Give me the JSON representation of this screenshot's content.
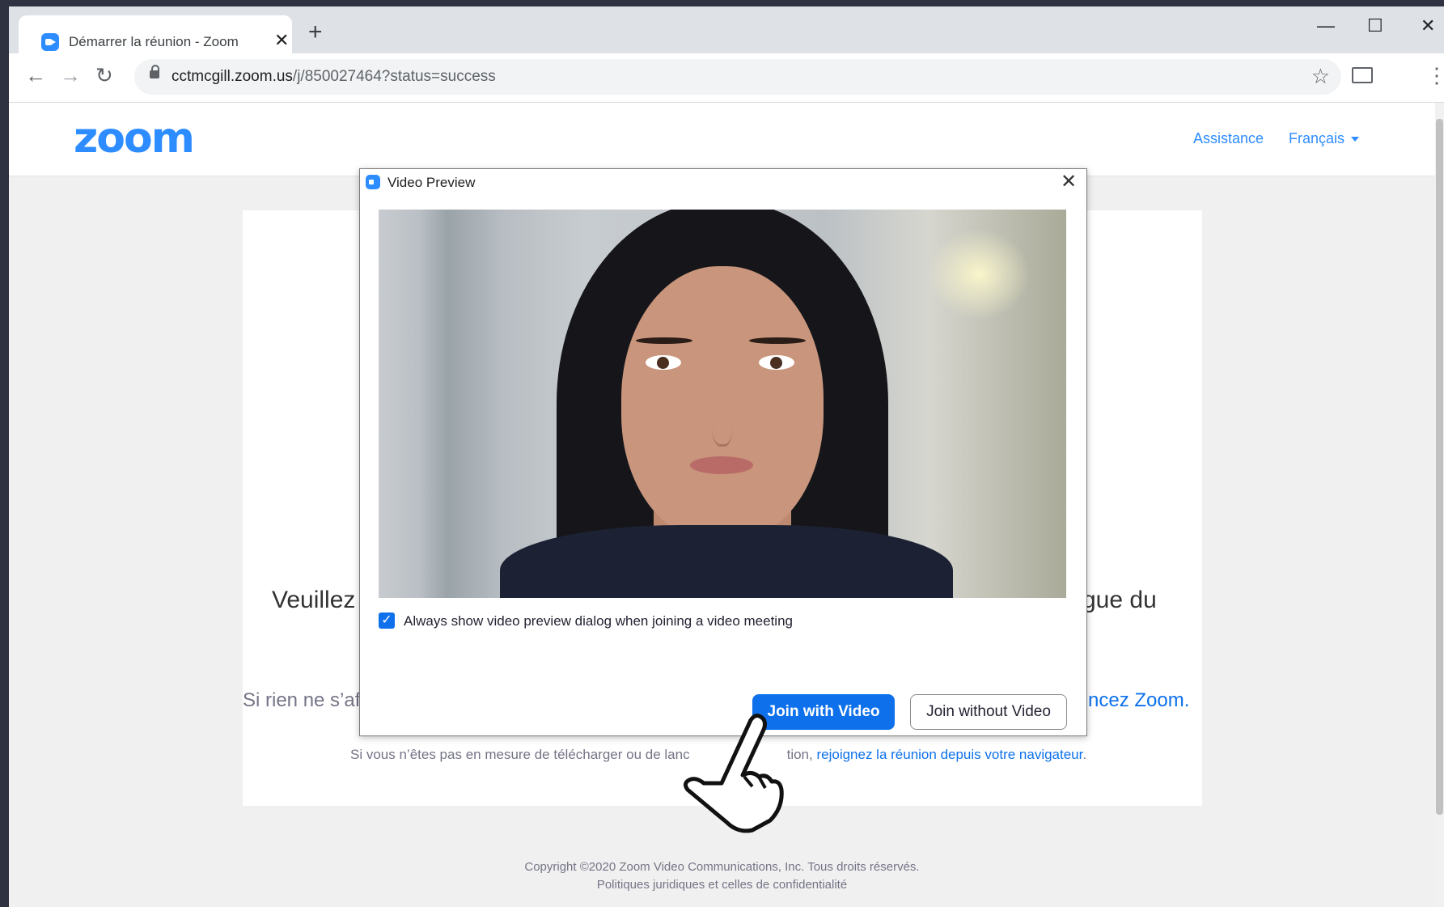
{
  "browser": {
    "tab_title": "Démarrer la réunion - Zoom",
    "tab_close": "✕",
    "new_tab": "+",
    "url_host": "cctmcgill.zoom.us",
    "url_path": "/j/850027464?status=success",
    "window_controls": {
      "minimize": "—",
      "maximize": "☐",
      "close": "✕"
    },
    "icons": [
      "back-arrow-icon",
      "forward-arrow-icon",
      "reload-icon",
      "lock-icon",
      "star-icon",
      "cast-icon",
      "more-menu-icon"
    ]
  },
  "zoom_page": {
    "logo": "zoom",
    "nav": {
      "support": "Assistance",
      "language": "Français"
    },
    "main_left": "Veuillez c",
    "main_right": "gue du",
    "hint_left": "Si rien ne s’aff",
    "hint_right": "ncez Zoom.",
    "fallback_text": "Si vous n’êtes pas en mesure de télécharger ou de lanc",
    "fallback_mid": "tion,",
    "fallback_link": "rejoignez la réunion depuis votre navigateur",
    "fallback_end": ".",
    "footer_copyright": "Copyright ©2020 Zoom Video Communications, Inc. Tous droits réservés.",
    "footer_legal": "Politiques juridiques et celles de confidentialité"
  },
  "dialog": {
    "title": "Video Preview",
    "close": "✕",
    "checkbox_checked": true,
    "checkbox_label": "Always show video preview dialog when joining a video meeting",
    "join_with_video": "Join with Video",
    "join_without_video": "Join without Video"
  },
  "colors": {
    "brand": "#2d8cff",
    "primary_button": "#0e71eb",
    "link": "#0e71eb"
  }
}
